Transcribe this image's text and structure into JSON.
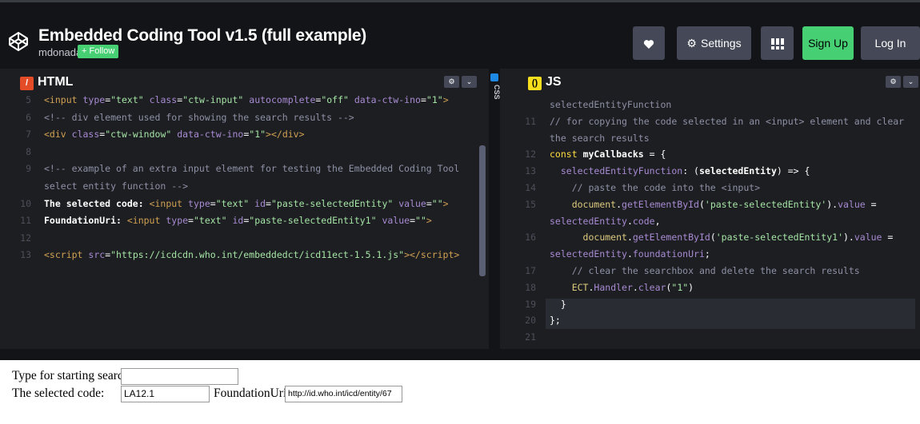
{
  "header": {
    "title": "Embedded Coding Tool v1.5 (full example)",
    "author": "mdonada",
    "follow_label": "+ Follow",
    "buttons": {
      "heart_icon": "heart-icon",
      "settings_label": "Settings",
      "settings_icon": "gear-icon",
      "layout_icon": "layout-grid-icon",
      "signup_label": "Sign Up",
      "login_label": "Log In"
    }
  },
  "panels": {
    "html": {
      "label": "HTML",
      "icon": "html-icon",
      "accent": "#e34c26",
      "lines": [
        {
          "n": "5",
          "html": "<span class=\"tok-tag\">&lt;input</span> <span class=\"tok-attr\">type</span>=<span class=\"tok-str\">\"text\"</span> <span class=\"tok-attr\">class</span>=<span class=\"tok-str\">\"ctw-input\"</span> <span class=\"tok-attr\">autocomplete</span>=<span class=\"tok-str\">\"off\"</span> <span class=\"tok-attr\">data-ctw-ino</span>=<span class=\"tok-str\">\"1\"</span><span class=\"tok-tag\">&gt;</span>"
        },
        {
          "n": "6",
          "html": "<span class=\"tok-com\">&lt;!-- div element used for showing the search results --&gt;</span>"
        },
        {
          "n": "7",
          "html": "<span class=\"tok-tag\">&lt;div</span> <span class=\"tok-attr\">class</span>=<span class=\"tok-str\">\"ctw-window\"</span> <span class=\"tok-attr\">data-ctw-ino</span>=<span class=\"tok-str\">\"1\"</span><span class=\"tok-tag\">&gt;&lt;/div&gt;</span>"
        },
        {
          "n": "8",
          "html": ""
        },
        {
          "n": "9",
          "html": "<span class=\"tok-com\">&lt;!-- example of an extra input element for testing the Embedded Coding Tool</span>"
        },
        {
          "n": "",
          "html": "<span class=\"tok-com\">select entity function --&gt;</span>"
        },
        {
          "n": "10",
          "html": "<span style=\"font-weight:bold\">The selected code: </span><span class=\"tok-tag\">&lt;input</span> <span class=\"tok-attr\">type</span>=<span class=\"tok-str\">\"text\"</span> <span class=\"tok-attr\">id</span>=<span class=\"tok-str\">\"paste-selectedEntity\"</span> <span class=\"tok-attr\">value</span>=<span class=\"tok-str\">\"\"</span><span class=\"tok-tag\">&gt;</span>"
        },
        {
          "n": "11",
          "html": "<span style=\"font-weight:bold\">FoundationUri: </span><span class=\"tok-tag\">&lt;input</span> <span class=\"tok-attr\">type</span>=<span class=\"tok-str\">\"text\"</span> <span class=\"tok-attr\">id</span>=<span class=\"tok-str\">\"paste-selectedEntity1\"</span> <span class=\"tok-attr\">value</span>=<span class=\"tok-str\">\"\"</span><span class=\"tok-tag\">&gt;</span>"
        },
        {
          "n": "12",
          "html": ""
        },
        {
          "n": "13",
          "html": "<span class=\"tok-tag\">&lt;script</span> <span class=\"tok-attr\">src</span>=<span class=\"tok-str\">\"https://icdcdn.who.int/embeddedct/icd11ect-1.5.1.js\"</span><span class=\"tok-tag\">&gt;&lt;/script&gt;</span>"
        }
      ]
    },
    "css": {
      "label": "CSS",
      "accent": "#1e88e5"
    },
    "js": {
      "label": "JS",
      "icon": "js-icon",
      "accent": "#f7df1e",
      "lines": [
        {
          "n": "",
          "html": "<span class=\"tok-com\">selectedEntityFunction</span>"
        },
        {
          "n": "11",
          "html": "<span class=\"tok-com\">// for copying the code selected in an &lt;input&gt; element and clear</span>"
        },
        {
          "n": "",
          "html": "<span class=\"tok-com\">the search results</span>"
        },
        {
          "n": "12",
          "html": "<span class=\"tok-key\">const</span> <span style=\"font-weight:bold\">myCallbacks</span> = {"
        },
        {
          "n": "13",
          "html": "  <span class=\"tok-attr\">selectedEntityFunction</span>: (<span style=\"font-weight:bold\">selectedEntity</span>) =&gt; {"
        },
        {
          "n": "14",
          "html": "    <span class=\"tok-com\">// paste the code into the &lt;input&gt;</span>"
        },
        {
          "n": "15",
          "html": "    <span class=\"tok-fn\">document</span>.<span class=\"tok-attr\">getElementById</span>(<span class=\"tok-str\">'paste-selectedEntity'</span>).<span class=\"tok-attr\">value</span> ="
        },
        {
          "n": "",
          "html": "<span class=\"tok-attr\">selectedEntity</span>.<span class=\"tok-attr\">code</span>,"
        },
        {
          "n": "16",
          "html": "      <span class=\"tok-fn\">document</span>.<span class=\"tok-attr\">getElementById</span>(<span class=\"tok-str\">'paste-selectedEntity1'</span>).<span class=\"tok-attr\">value</span> ="
        },
        {
          "n": "",
          "html": "<span class=\"tok-attr\">selectedEntity</span>.<span class=\"tok-attr\">foundationUri</span>;"
        },
        {
          "n": "17",
          "html": "    <span class=\"tok-com\">// clear the searchbox and delete the search results</span>"
        },
        {
          "n": "18",
          "html": "    <span class=\"tok-fn\">ECT</span>.<span class=\"tok-attr\">Handler</span>.<span class=\"tok-attr\">clear</span>(<span class=\"tok-str\">\"1\"</span>)"
        },
        {
          "n": "19",
          "html": "  }"
        },
        {
          "n": "20",
          "html": "};"
        },
        {
          "n": "21",
          "html": ""
        }
      ]
    }
  },
  "output": {
    "search_label": "Type for starting search:",
    "search_value": "",
    "selected_label": "The selected code:",
    "selected_value": "LA12.1",
    "uri_label": "FoundationUri:",
    "uri_value": "http://id.who.int/icd/entity/67"
  }
}
